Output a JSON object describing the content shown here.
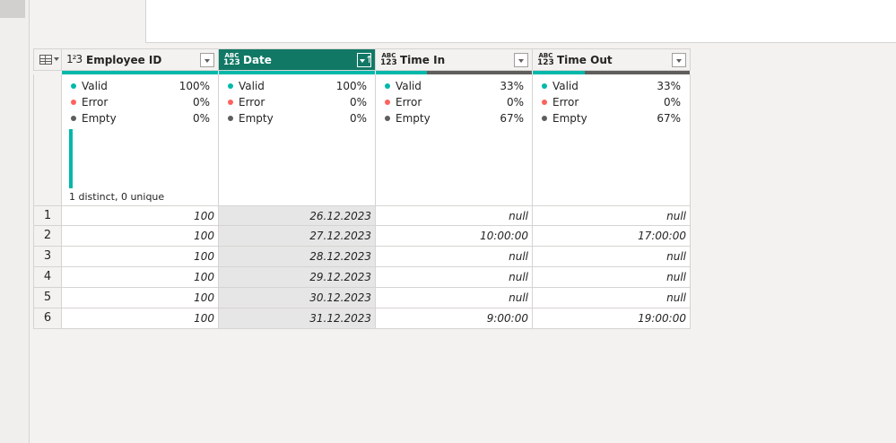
{
  "columns": [
    {
      "name": "Employee ID",
      "type_icon": "123",
      "valid": "100%",
      "error": "0%",
      "empty": "0%",
      "valid_fraction": 1.0,
      "distribution_label": "1 distinct, 0 unique"
    },
    {
      "name": "Date",
      "type_icon": "ABC 123",
      "valid": "100%",
      "error": "0%",
      "empty": "0%",
      "valid_fraction": 1.0,
      "sorted": "ascending"
    },
    {
      "name": "Time In",
      "type_icon": "ABC 123",
      "valid": "33%",
      "error": "0%",
      "empty": "67%",
      "valid_fraction": 0.33
    },
    {
      "name": "Time Out",
      "type_icon": "ABC 123",
      "valid": "33%",
      "error": "0%",
      "empty": "67%",
      "valid_fraction": 0.33
    }
  ],
  "stat_labels": {
    "valid": "Valid",
    "error": "Error",
    "empty": "Empty"
  },
  "type_icons": {
    "abc": "ABC",
    "n123": "123",
    "num": "1²3"
  },
  "rows": [
    {
      "num": "1",
      "employee_id": "100",
      "date": "26.12.2023",
      "time_in": "null",
      "time_out": "null"
    },
    {
      "num": "2",
      "employee_id": "100",
      "date": "27.12.2023",
      "time_in": "10:00:00",
      "time_out": "17:00:00"
    },
    {
      "num": "3",
      "employee_id": "100",
      "date": "28.12.2023",
      "time_in": "null",
      "time_out": "null"
    },
    {
      "num": "4",
      "employee_id": "100",
      "date": "29.12.2023",
      "time_in": "null",
      "time_out": "null"
    },
    {
      "num": "5",
      "employee_id": "100",
      "date": "30.12.2023",
      "time_in": "null",
      "time_out": "null"
    },
    {
      "num": "6",
      "employee_id": "100",
      "date": "31.12.2023",
      "time_in": "9:00:00",
      "time_out": "19:00:00"
    }
  ],
  "colors": {
    "valid": "#01b8aa",
    "error": "#fd625e",
    "empty": "#605e5c",
    "selected_header": "#117865"
  }
}
